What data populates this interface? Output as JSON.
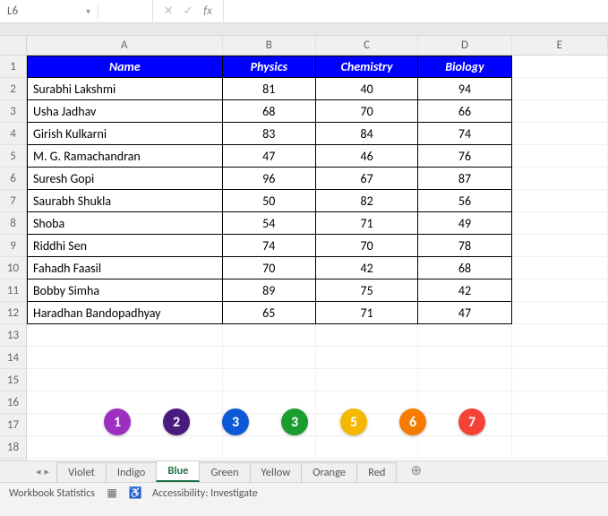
{
  "name_box": "L6",
  "formula_input": "",
  "col_letters": [
    "A",
    "B",
    "C",
    "D",
    "E"
  ],
  "row_numbers": [
    "1",
    "2",
    "3",
    "4",
    "5",
    "6",
    "7",
    "8",
    "9",
    "10",
    "11",
    "12",
    "13",
    "14",
    "15",
    "16",
    "17",
    "18"
  ],
  "table": {
    "headers": [
      "Name",
      "Physics",
      "Chemistry",
      "Biology"
    ],
    "rows": [
      {
        "name": "Surabhi Lakshmi",
        "physics": "81",
        "chemistry": "40",
        "biology": "94"
      },
      {
        "name": "Usha Jadhav",
        "physics": "68",
        "chemistry": "70",
        "biology": "66"
      },
      {
        "name": "Girish Kulkarni",
        "physics": "83",
        "chemistry": "84",
        "biology": "74"
      },
      {
        "name": "M. G. Ramachandran",
        "physics": "47",
        "chemistry": "46",
        "biology": "76"
      },
      {
        "name": "Suresh Gopi",
        "physics": "96",
        "chemistry": "67",
        "biology": "87"
      },
      {
        "name": "Saurabh Shukla",
        "physics": "50",
        "chemistry": "82",
        "biology": "56"
      },
      {
        "name": "Shoba",
        "physics": "54",
        "chemistry": "71",
        "biology": "49"
      },
      {
        "name": "Riddhi Sen",
        "physics": "74",
        "chemistry": "70",
        "biology": "78"
      },
      {
        "name": "Fahadh Faasil",
        "physics": "70",
        "chemistry": "42",
        "biology": "68"
      },
      {
        "name": "Bobby Simha",
        "physics": "89",
        "chemistry": "75",
        "biology": "42"
      },
      {
        "name": "Haradhan Bandopadhyay",
        "physics": "65",
        "chemistry": "71",
        "biology": "47"
      }
    ]
  },
  "badges": [
    {
      "label": "1",
      "color": "#9b2fbf"
    },
    {
      "label": "2",
      "color": "#4a1b7f"
    },
    {
      "label": "3",
      "color": "#0b59d6"
    },
    {
      "label": "3",
      "color": "#1a9c2e"
    },
    {
      "label": "5",
      "color": "#f5b800"
    },
    {
      "label": "6",
      "color": "#f57c00"
    },
    {
      "label": "7",
      "color": "#f44336"
    }
  ],
  "sheets": [
    {
      "label": "Violet",
      "active": false
    },
    {
      "label": "Indigo",
      "active": false
    },
    {
      "label": "Blue",
      "active": true
    },
    {
      "label": "Green",
      "active": false
    },
    {
      "label": "Yellow",
      "active": false
    },
    {
      "label": "Orange",
      "active": false
    },
    {
      "label": "Red",
      "active": false
    }
  ],
  "status": {
    "workbook_stats": "Workbook Statistics",
    "accessibility": "Accessibility: Investigate"
  }
}
